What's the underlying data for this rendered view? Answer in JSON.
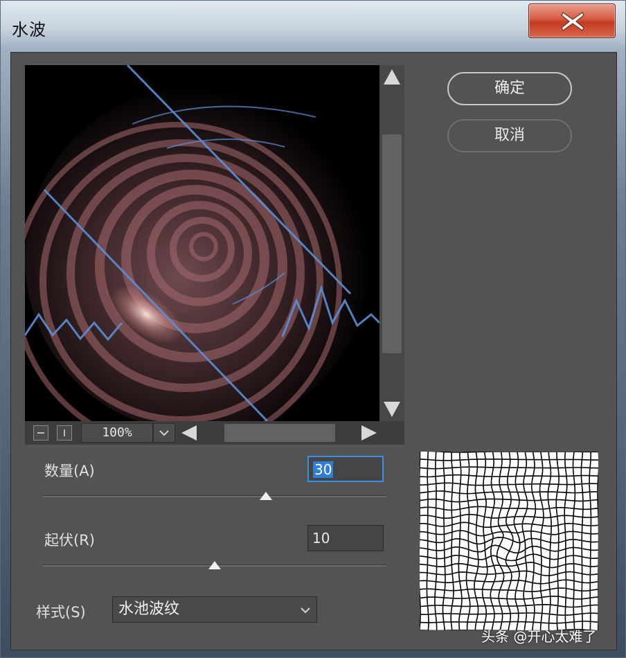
{
  "window": {
    "title": "水波",
    "close_icon": "close-x-icon"
  },
  "preview": {
    "zoom_level": "100%",
    "zoom_out_icon": "zoom-out-icon",
    "zoom_in_icon": "zoom-in-icon",
    "dropdown_icon": "chevron-down-icon"
  },
  "buttons": {
    "ok_label": "确定",
    "cancel_label": "取消"
  },
  "params": {
    "amount": {
      "label": "数量(A)",
      "value": "30",
      "slider_fraction": 0.65
    },
    "ridges": {
      "label": "起伏(R)",
      "value": "10",
      "slider_fraction": 0.5
    },
    "style": {
      "label": "样式(S)",
      "value": "水池波纹"
    }
  },
  "watermark": "头条 @开心太难了",
  "colors": {
    "close_red": "#c9472d",
    "focus_blue": "#3d8ee6",
    "panel_gray": "#535353"
  }
}
